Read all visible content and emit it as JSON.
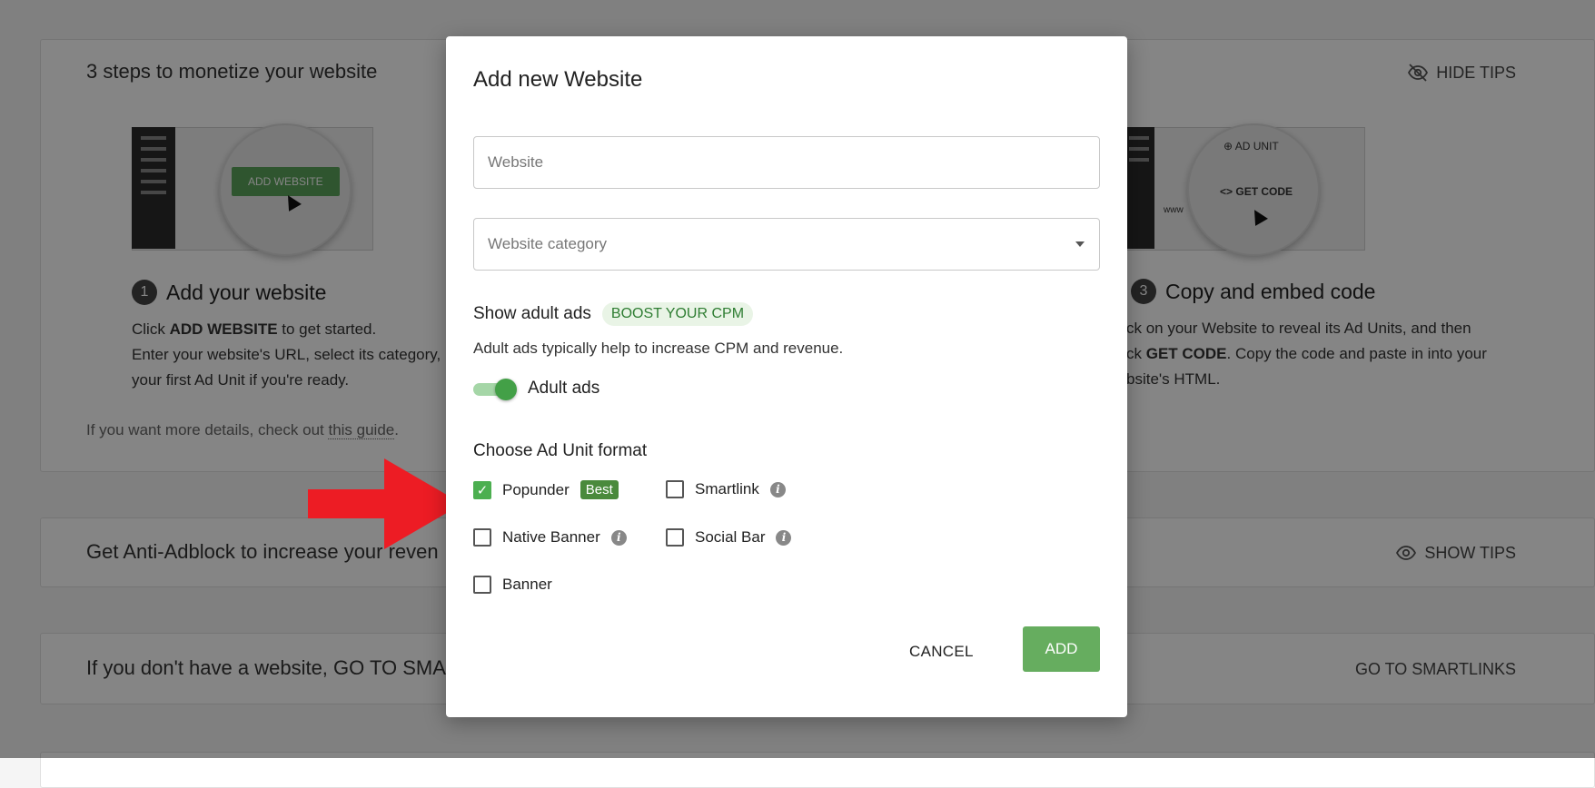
{
  "background": {
    "steps_card": {
      "title": "3 steps to monetize your website",
      "hide_tips": "HIDE TIPS",
      "step1": {
        "number": "1",
        "title": "Add your website",
        "line1_pre": "Click ",
        "line1_bold": "ADD WEBSITE",
        "line1_post": " to get started.",
        "line2": "Enter your website's URL, select its category,",
        "line3": "your first Ad Unit if you're ready.",
        "illus_button": "ADD WEBSITE"
      },
      "step3": {
        "number": "3",
        "title": "Copy and embed code",
        "line1": "ck on your Website to reveal its Ad Units, and then",
        "line2_pre": "ck ",
        "line2_bold": "GET CODE",
        "line2_post": ". Copy the code and paste in into your",
        "line3": "bsite's HTML.",
        "illus_ad_unit": "AD UNIT",
        "illus_get_code": "GET CODE",
        "illus_www": "www"
      },
      "guide_pre": "If you want more details, check out ",
      "guide_link": "this guide",
      "guide_post": "."
    },
    "anti_card": {
      "title": "Get Anti-Adblock to increase your reven",
      "show_tips": "SHOW TIPS"
    },
    "nosite_card": {
      "title": "If you don't have a website, GO TO SMA",
      "link": "GO TO SMARTLINKS"
    }
  },
  "modal": {
    "title": "Add new Website",
    "website_placeholder": "Website",
    "category_placeholder": "Website category",
    "adult_title": "Show adult ads",
    "boost_badge": "BOOST YOUR CPM",
    "adult_desc": "Adult ads typically help to increase CPM and revenue.",
    "toggle_label": "Adult ads",
    "toggle_on": true,
    "format_title": "Choose Ad Unit format",
    "formats": {
      "popunder": {
        "label": "Popunder",
        "badge": "Best",
        "checked": true
      },
      "smartlink": {
        "label": "Smartlink",
        "checked": false
      },
      "native": {
        "label": "Native Banner",
        "checked": false
      },
      "social": {
        "label": "Social Bar",
        "checked": false
      },
      "banner": {
        "label": "Banner",
        "checked": false
      }
    },
    "cancel_label": "CANCEL",
    "add_label": "ADD"
  },
  "colors": {
    "accent_green": "#66ad5f",
    "badge_green": "#4a8a3c",
    "arrow_red": "#ed1c24"
  }
}
